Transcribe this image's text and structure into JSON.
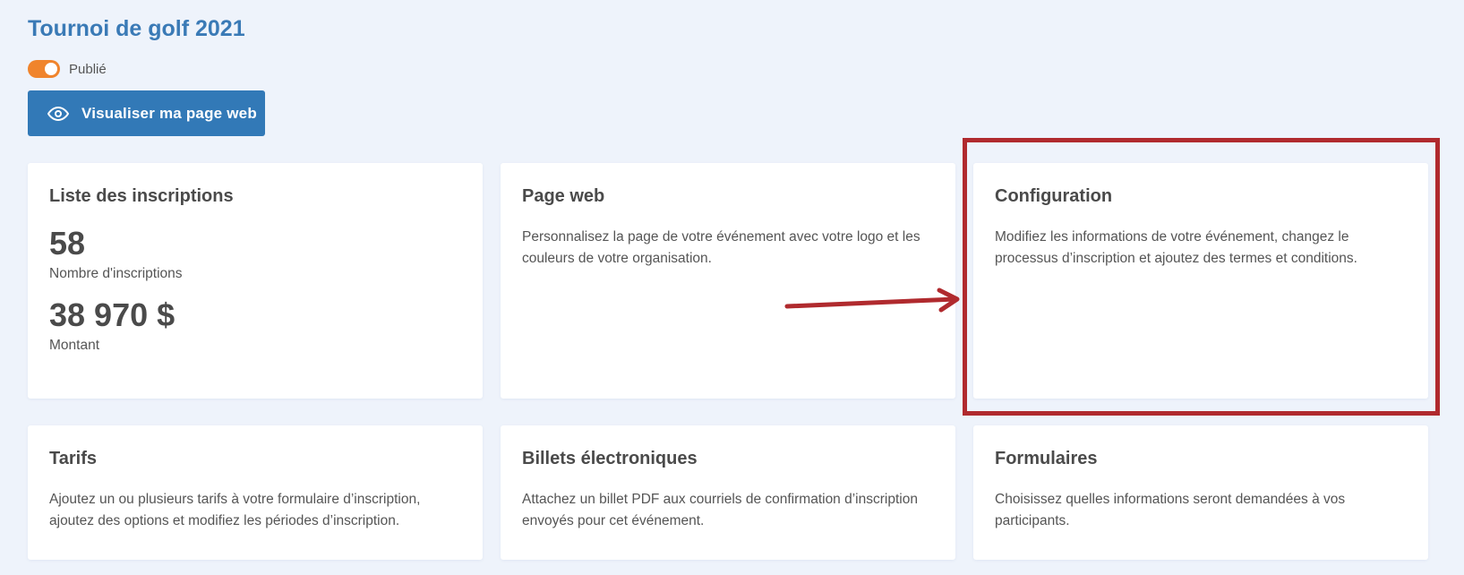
{
  "header": {
    "title": "Tournoi de golf 2021",
    "status_label": "Publié",
    "view_button_label": "Visualiser ma page web"
  },
  "cards": {
    "registrations": {
      "title": "Liste des inscriptions",
      "count_value": "58",
      "count_label": "Nombre d'inscriptions",
      "amount_value": "38 970 $",
      "amount_label": "Montant"
    },
    "webpage": {
      "title": "Page web",
      "description": "Personnalisez la page de votre événement avec votre logo et les couleurs de votre organisation."
    },
    "configuration": {
      "title": "Configuration",
      "description": "Modifiez les informations de votre événement, changez le processus d’inscription et ajoutez des termes et conditions."
    },
    "tarifs": {
      "title": "Tarifs",
      "description": "Ajoutez un ou plusieurs tarifs à votre formulaire d’inscription, ajoutez des options et modifiez les périodes d’inscription."
    },
    "tickets": {
      "title": "Billets électroniques",
      "description": "Attachez un billet PDF aux courriels de confirmation d’inscription envoyés pour cet événement."
    },
    "forms": {
      "title": "Formulaires",
      "description": "Choisissez quelles informations seront demandées à vos participants."
    }
  },
  "colors": {
    "background": "#eef3fb",
    "title": "#3a7ab6",
    "button": "#3279b7",
    "toggle_on": "#f0842c",
    "annotation": "#b02a2e"
  },
  "icons": {
    "view_button": "eye-icon"
  }
}
